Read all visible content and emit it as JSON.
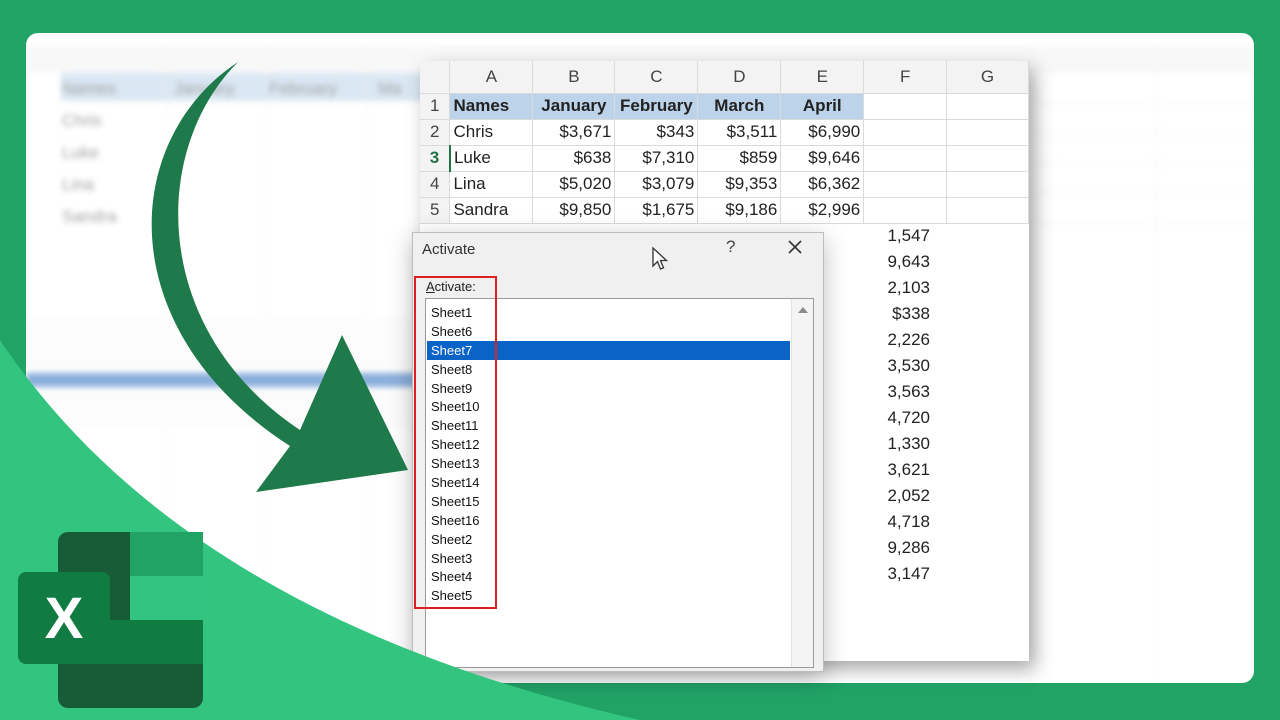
{
  "columns": [
    "A",
    "B",
    "C",
    "D",
    "E",
    "F",
    "G"
  ],
  "header_row": [
    "Names",
    "January",
    "February",
    "March",
    "April"
  ],
  "rows": [
    {
      "num": "2",
      "cells": [
        "Chris",
        "$3,671",
        "$343",
        "$3,511",
        "$6,990"
      ]
    },
    {
      "num": "3",
      "cells": [
        "Luke",
        "$638",
        "$7,310",
        "$859",
        "$9,646"
      ]
    },
    {
      "num": "4",
      "cells": [
        "Lina",
        "$5,020",
        "$3,079",
        "$9,353",
        "$6,362"
      ]
    },
    {
      "num": "5",
      "cells": [
        "Sandra",
        "$9,850",
        "$1,675",
        "$9,186",
        "$2,996"
      ]
    }
  ],
  "partial_column_e": [
    "1,547",
    "9,643",
    "2,103",
    "$338",
    "2,226",
    "3,530",
    "3,563",
    "4,720",
    "1,330",
    "3,621",
    "2,052",
    "4,718",
    "9,286",
    "3,147"
  ],
  "active_row": "3",
  "dialog": {
    "title": "Activate",
    "help": "?",
    "label": "Activate:",
    "label_accel": "A",
    "label_rest": "ctivate:",
    "items": [
      "Sheet1",
      "Sheet6",
      "Sheet7",
      "Sheet8",
      "Sheet9",
      "Sheet10",
      "Sheet11",
      "Sheet12",
      "Sheet13",
      "Sheet14",
      "Sheet15",
      "Sheet16",
      "Sheet2",
      "Sheet3",
      "Sheet4",
      "Sheet5"
    ],
    "selected": "Sheet7"
  },
  "background": {
    "names": [
      "Names",
      "Chris",
      "Luke",
      "Lina",
      "Sandra"
    ],
    "months": [
      "January",
      "February",
      "Ma"
    ]
  },
  "logo": {
    "letter": "X"
  },
  "colors": {
    "brand_green": "#21a366",
    "excel_dark": "#185c37",
    "selection_blue": "#0a64c8",
    "highlight_red": "#e02020",
    "header_fill": "#bcd3ea"
  }
}
